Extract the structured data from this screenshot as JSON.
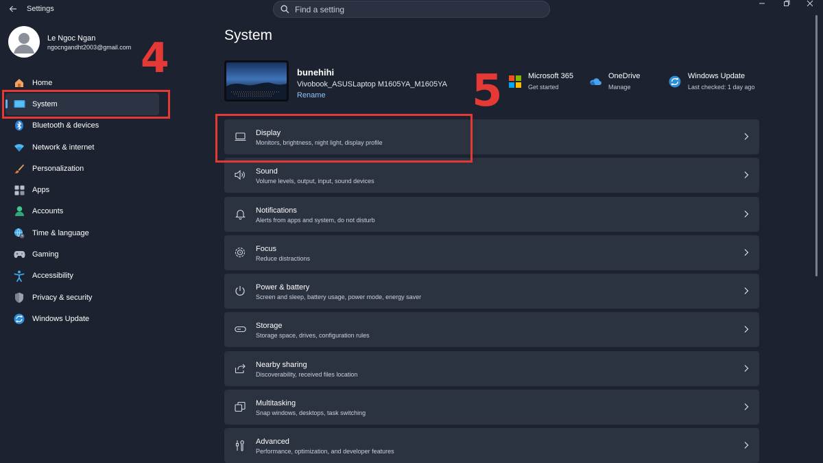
{
  "titlebar": {
    "app_title": "Settings",
    "back_icon": "back-arrow-icon"
  },
  "search": {
    "placeholder": "Find a setting"
  },
  "profile": {
    "name": "Le Ngoc Ngan",
    "email": "ngocngandht2003@gmail.com"
  },
  "sidebar": {
    "items": [
      {
        "label": "Home",
        "icon": "home-icon",
        "selected": false
      },
      {
        "label": "System",
        "icon": "system-icon",
        "selected": true
      },
      {
        "label": "Bluetooth & devices",
        "icon": "bluetooth-icon",
        "selected": false
      },
      {
        "label": "Network & internet",
        "icon": "wifi-icon",
        "selected": false
      },
      {
        "label": "Personalization",
        "icon": "brush-icon",
        "selected": false
      },
      {
        "label": "Apps",
        "icon": "apps-icon",
        "selected": false
      },
      {
        "label": "Accounts",
        "icon": "person-icon",
        "selected": false
      },
      {
        "label": "Time & language",
        "icon": "globe-clock-icon",
        "selected": false
      },
      {
        "label": "Gaming",
        "icon": "gamepad-icon",
        "selected": false
      },
      {
        "label": "Accessibility",
        "icon": "accessibility-icon",
        "selected": false
      },
      {
        "label": "Privacy & security",
        "icon": "shield-icon",
        "selected": false
      },
      {
        "label": "Windows Update",
        "icon": "update-icon",
        "selected": false
      }
    ]
  },
  "annotations": {
    "step4": "4",
    "step5": "5",
    "color": "#e53935"
  },
  "main": {
    "title": "System",
    "device": {
      "name": "bunehihi",
      "model": "Vivobook_ASUSLaptop M1605YA_M1605YA",
      "rename": "Rename"
    },
    "quick_links": [
      {
        "title": "Microsoft 365",
        "subtitle": "Get started",
        "icon": "microsoft-logo-icon"
      },
      {
        "title": "OneDrive",
        "subtitle": "Manage",
        "icon": "onedrive-icon"
      },
      {
        "title": "Windows Update",
        "subtitle": "Last checked: 1 day ago",
        "icon": "update-icon"
      }
    ],
    "cards": [
      {
        "title": "Display",
        "subtitle": "Monitors, brightness, night light, display profile",
        "icon": "display-icon"
      },
      {
        "title": "Sound",
        "subtitle": "Volume levels, output, input, sound devices",
        "icon": "speaker-icon"
      },
      {
        "title": "Notifications",
        "subtitle": "Alerts from apps and system, do not disturb",
        "icon": "bell-icon"
      },
      {
        "title": "Focus",
        "subtitle": "Reduce distractions",
        "icon": "focus-icon"
      },
      {
        "title": "Power & battery",
        "subtitle": "Screen and sleep, battery usage, power mode, energy saver",
        "icon": "power-icon"
      },
      {
        "title": "Storage",
        "subtitle": "Storage space, drives, configuration rules",
        "icon": "storage-icon"
      },
      {
        "title": "Nearby sharing",
        "subtitle": "Discoverability, received files location",
        "icon": "share-icon"
      },
      {
        "title": "Multitasking",
        "subtitle": "Snap windows, desktops, task switching",
        "icon": "multitasking-icon"
      },
      {
        "title": "Advanced",
        "subtitle": "Performance, optimization, and developer features",
        "icon": "tools-icon"
      }
    ]
  },
  "colors": {
    "background": "#1c2230",
    "card": "#2b3240",
    "accent": "#5fb2f2",
    "link": "#8ec7f5"
  }
}
